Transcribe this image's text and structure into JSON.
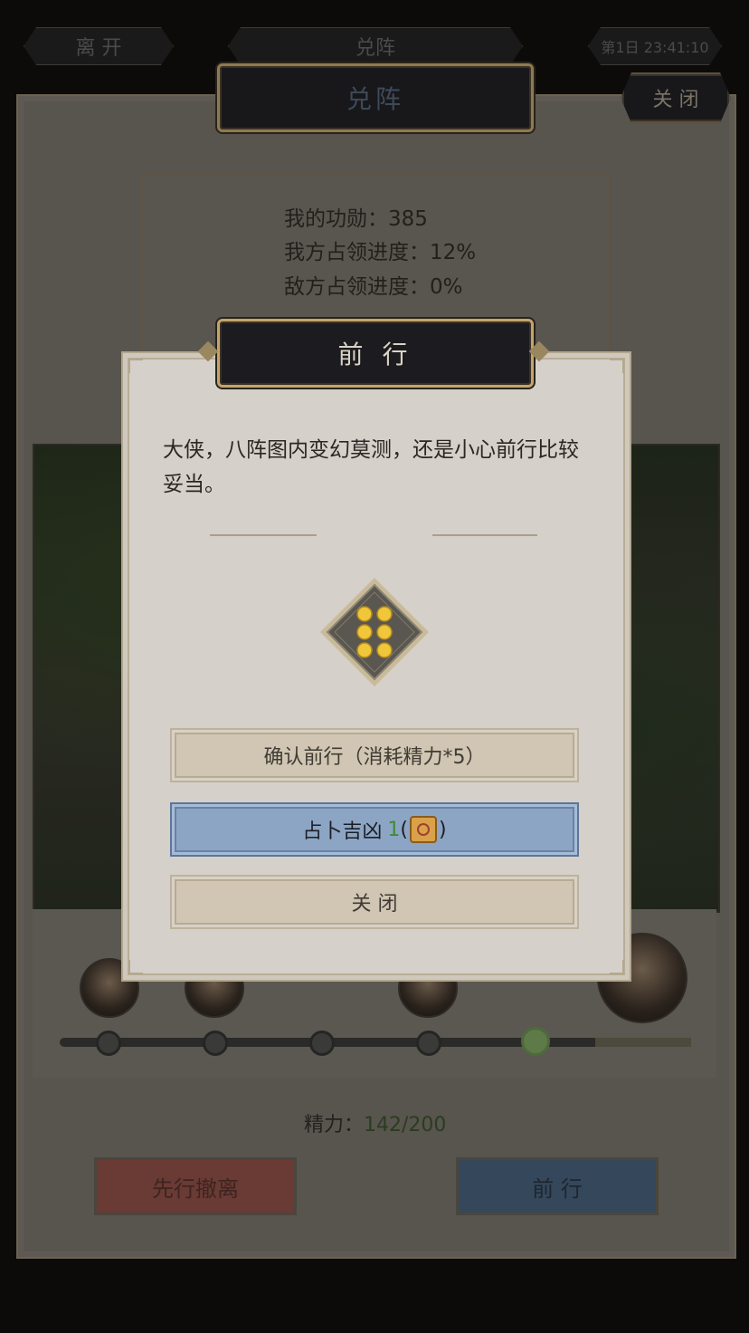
{
  "topbar": {
    "left_label": "离 开",
    "center_label": "兑阵",
    "right_label": "第1日 23:41:10"
  },
  "panel": {
    "title": "兑阵",
    "close_label": "关 闭",
    "info": {
      "merit_label": "我的功勋：",
      "merit_value": "385",
      "our_progress_label": "我方占领进度：",
      "our_progress_value": "12%",
      "enemy_progress_label": "敌方占领进度：",
      "enemy_progress_value": "0%"
    },
    "track": {
      "progress_fraction": 0.85,
      "nodes": 5,
      "active_node": 5
    },
    "stamina_label": "精力：",
    "stamina_value": "142/200",
    "retreat_label": "先行撤离",
    "advance_label": "前 行"
  },
  "dialog": {
    "title": "前 行",
    "message": "大侠，八阵图内变幻莫测，还是小心前行比较妥当。",
    "dice_value": 6,
    "confirm_label": "确认前行（消耗精力*5）",
    "divine_label_before": "占卜吉凶",
    "divine_count": "1",
    "divine_paren_open": "(",
    "divine_paren_close": ")",
    "close_label": "关 闭"
  },
  "colors": {
    "dialog_bg": "#d5d0c9",
    "blue_button": "#8da5c4",
    "beige_button": "#d0c6b3",
    "count_green": "#3e8c35",
    "plaque_border": "#8e7a52"
  }
}
